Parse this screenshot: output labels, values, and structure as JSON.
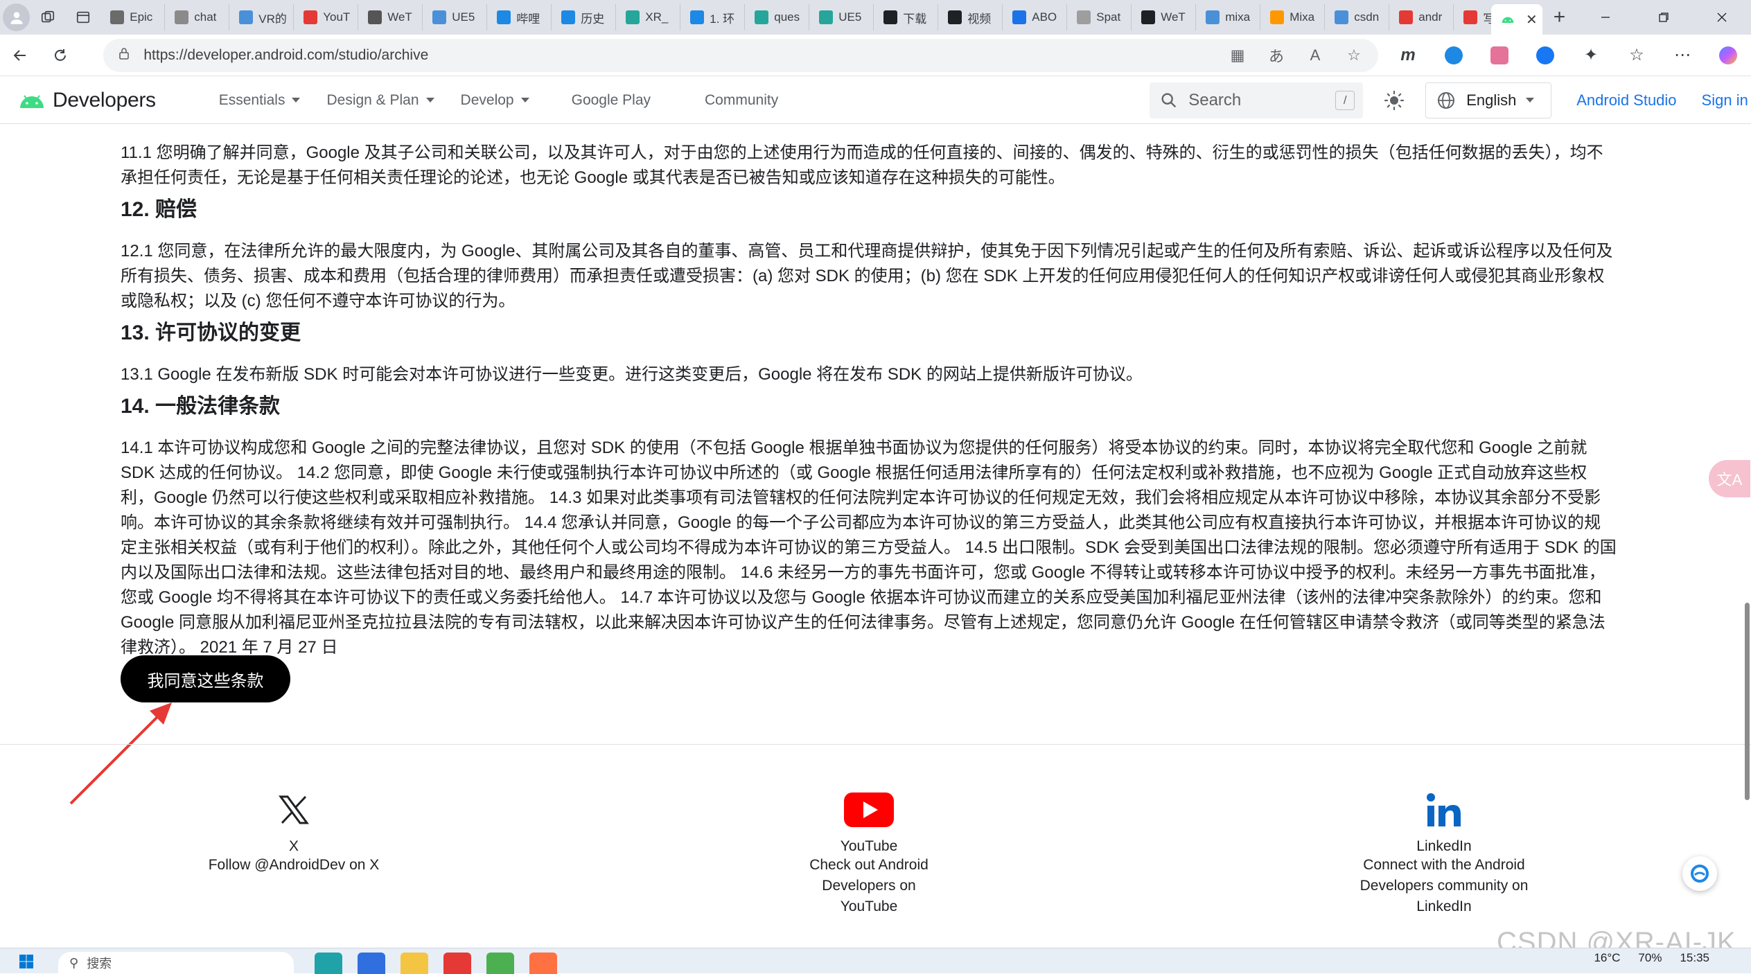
{
  "browser": {
    "tabs": [
      {
        "label": "Epic",
        "fav_color": "#6b6b6b"
      },
      {
        "label": "chat",
        "fav_color": "#8a8a8a"
      },
      {
        "label": "VR的",
        "fav_color": "#4a90d9"
      },
      {
        "label": "YouT",
        "fav_color": "#e53935"
      },
      {
        "label": "WeT",
        "fav_color": "#555555"
      },
      {
        "label": "UE5",
        "fav_color": "#4a90d9"
      },
      {
        "label": "哔哩",
        "fav_color": "#1e88e5"
      },
      {
        "label": "历史",
        "fav_color": "#1e88e5"
      },
      {
        "label": "XR_",
        "fav_color": "#26a69a"
      },
      {
        "label": "1. 环",
        "fav_color": "#1e88e5"
      },
      {
        "label": "ques",
        "fav_color": "#26a69a"
      },
      {
        "label": "UE5",
        "fav_color": "#26a69a"
      },
      {
        "label": "下载",
        "fav_color": "#202124"
      },
      {
        "label": "视频",
        "fav_color": "#202124"
      },
      {
        "label": "ABO",
        "fav_color": "#1a73e8"
      },
      {
        "label": "Spat",
        "fav_color": "#9e9e9e"
      },
      {
        "label": "WeT",
        "fav_color": "#202124"
      },
      {
        "label": "mixa",
        "fav_color": "#4a90d9"
      },
      {
        "label": "Mixa",
        "fav_color": "#ff9800"
      },
      {
        "label": "csdn",
        "fav_color": "#4a90d9"
      },
      {
        "label": "andr",
        "fav_color": "#e53935"
      },
      {
        "label": "写文",
        "fav_color": "#e53935"
      }
    ],
    "active_tab_icon": "android-icon",
    "new_tab_label": "+",
    "url": "https://developer.android.com/studio/archive"
  },
  "site": {
    "brand": "Developers",
    "nav": [
      {
        "label": "Essentials",
        "has_menu": true
      },
      {
        "label": "Design & Plan",
        "has_menu": true
      },
      {
        "label": "Develop",
        "has_menu": true
      },
      {
        "label": "Google Play",
        "has_menu": false
      },
      {
        "label": "Community",
        "has_menu": false
      }
    ],
    "search_placeholder": "Search",
    "search_shortcut": "/",
    "language": "English",
    "studio_link": "Android Studio",
    "signin_link": "Sign in"
  },
  "content": {
    "p11_1": "11.1 您明确了解并同意，Google 及其子公司和关联公司，以及其许可人，对于由您的上述使用行为而造成的任何直接的、间接的、偶发的、特殊的、衍生的或惩罚性的损失（包括任何数据的丢失），均不承担任何责任，无论是基于任何相关责任理论的论述，也无论 Google 或其代表是否已被告知或应该知道存在这种损失的可能性。",
    "h12": "12. 赔偿",
    "p12_1": "12.1 您同意，在法律所允许的最大限度内，为 Google、其附属公司及其各自的董事、高管、员工和代理商提供辩护，使其免于因下列情况引起或产生的任何及所有索赔、诉讼、起诉或诉讼程序以及任何及所有损失、债务、损害、成本和费用（包括合理的律师费用）而承担责任或遭受损害：(a) 您对 SDK 的使用；(b) 您在 SDK 上开发的任何应用侵犯任何人的任何知识产权或诽谤任何人或侵犯其商业形象权或隐私权；以及 (c) 您任何不遵守本许可协议的行为。",
    "h13": "13. 许可协议的变更",
    "p13_1": "13.1 Google 在发布新版 SDK 时可能会对本许可协议进行一些变更。进行这类变更后，Google 将在发布 SDK 的网站上提供新版许可协议。",
    "h14": "14. 一般法律条款",
    "p14": "14.1 本许可协议构成您和 Google 之间的完整法律协议，且您对 SDK 的使用（不包括 Google 根据单独书面协议为您提供的任何服务）将受本协议的约束。同时，本协议将完全取代您和 Google 之前就 SDK 达成的任何协议。 14.2 您同意，即使 Google 未行使或强制执行本许可协议中所述的（或 Google 根据任何适用法律所享有的）任何法定权利或补救措施，也不应视为 Google 正式自动放弃这些权利，Google 仍然可以行使这些权利或采取相应补救措施。 14.3 如果对此类事项有司法管辖权的任何法院判定本许可协议的任何规定无效，我们会将相应规定从本许可协议中移除，本协议其余部分不受影响。本许可协议的其余条款将继续有效并可强制执行。 14.4 您承认并同意，Google 的每一个子公司都应为本许可协议的第三方受益人，此类其他公司应有权直接执行本许可协议，并根据本许可协议的规定主张相关权益（或有利于他们的权利）。除此之外，其他任何个人或公司均不得成为本许可协议的第三方受益人。 14.5 出口限制。SDK 会受到美国出口法律法规的限制。您必须遵守所有适用于 SDK 的国内以及国际出口法律和法规。这些法律包括对目的地、最终用户和最终用途的限制。 14.6 未经另一方的事先书面许可，您或 Google 不得转让或转移本许可协议中授予的权利。未经另一方事先书面批准，您或 Google 均不得将其在本许可协议下的责任或义务委托给他人。 14.7 本许可协议以及您与 Google 依据本许可协议而建立的关系应受美国加利福尼亚州法律（该州的法律冲突条款除外）的约束。您和 Google 同意服从加利福尼亚州圣克拉拉县法院的专有司法辖权，以此来解决因本许可协议产生的任何法律事务。尽管有上述规定，您同意仍允许 Google 在任何管辖区申请禁令救济（或同等类型的紧急法律救济）。 2021 年 7 月 27 日",
    "agree_button": "我同意这些条款"
  },
  "footer": {
    "socials": [
      {
        "icon": "x-icon",
        "title": "X",
        "desc": "Follow @AndroidDev on X"
      },
      {
        "icon": "youtube-icon",
        "title": "YouTube",
        "desc": "Check out Android Developers on YouTube"
      },
      {
        "icon": "linkedin-icon",
        "title": "LinkedIn",
        "desc": "Connect with the Android Developers community on LinkedIn"
      }
    ]
  },
  "watermark": "CSDN @XR-AI-JK",
  "taskbar": {
    "search_placeholder": "搜索",
    "weather": "16°C",
    "battery": "70%",
    "clock": "15:35"
  },
  "colors": {
    "link_blue": "#1a73e8",
    "android_green": "#3ddc84",
    "youtube_red": "#ff0000",
    "linkedin_blue": "#0a66c2",
    "annotation_red": "#e53935"
  }
}
